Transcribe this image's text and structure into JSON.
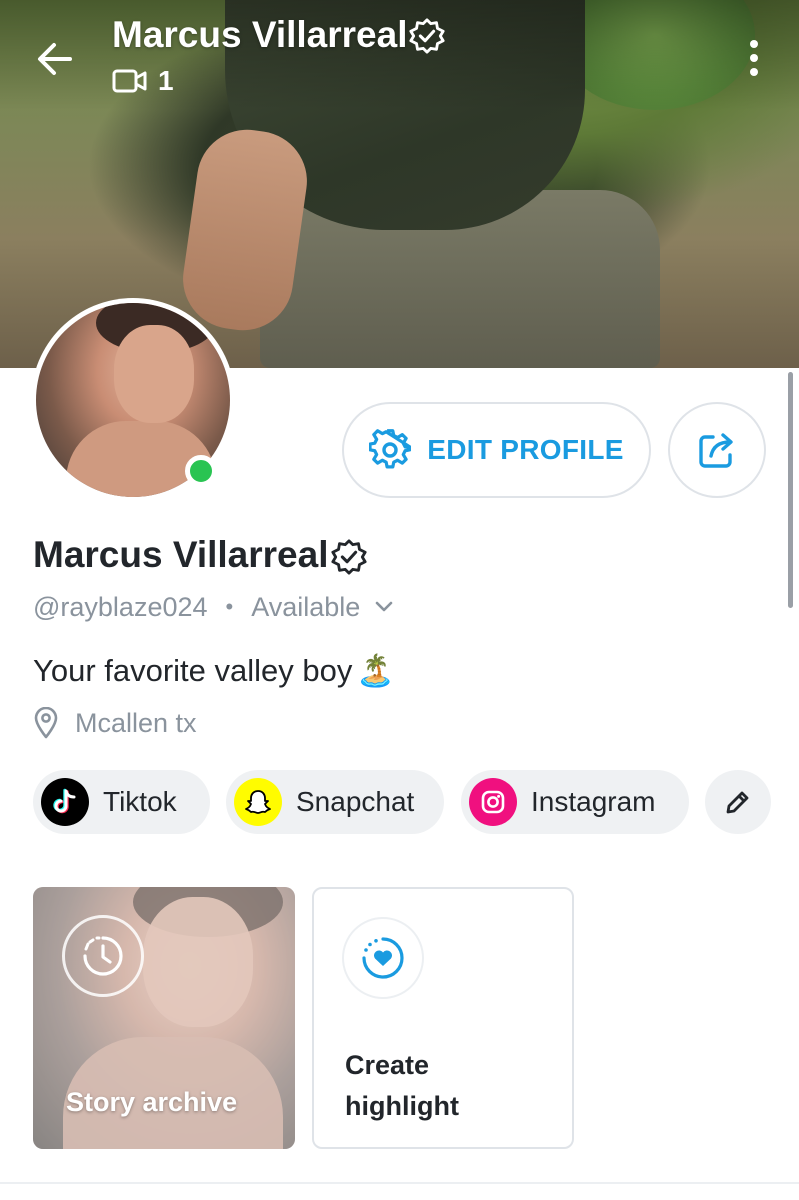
{
  "header": {
    "title": "Marcus Villarreal",
    "media_count": "1",
    "icons": {
      "back": "arrow-left-icon",
      "verified": "verified-badge-icon",
      "video": "video-camera-icon",
      "more": "more-vertical-icon"
    }
  },
  "actions": {
    "edit_profile_label": "EDIT PROFILE",
    "edit_icon": "gear-icon",
    "share_icon": "share-icon",
    "accent_color": "#1a9be0"
  },
  "profile": {
    "name": "Marcus Villarreal",
    "handle": "@rayblaze024",
    "separator": "•",
    "status": "Available",
    "bio": "Your favorite valley boy",
    "bio_emoji": "🏝️",
    "location": "Mcallen tx",
    "online_color": "#29c452"
  },
  "socials": [
    {
      "label": "Tiktok",
      "icon": "tiktok-icon",
      "color": "#000000"
    },
    {
      "label": "Snapchat",
      "icon": "snapchat-icon",
      "color": "#fffc00"
    },
    {
      "label": "Instagram",
      "icon": "instagram-icon",
      "color": "#f0107f"
    }
  ],
  "socials_edit_icon": "pencil-icon",
  "highlights": {
    "archive_label": "Story archive",
    "create_label": "Create highlight"
  }
}
